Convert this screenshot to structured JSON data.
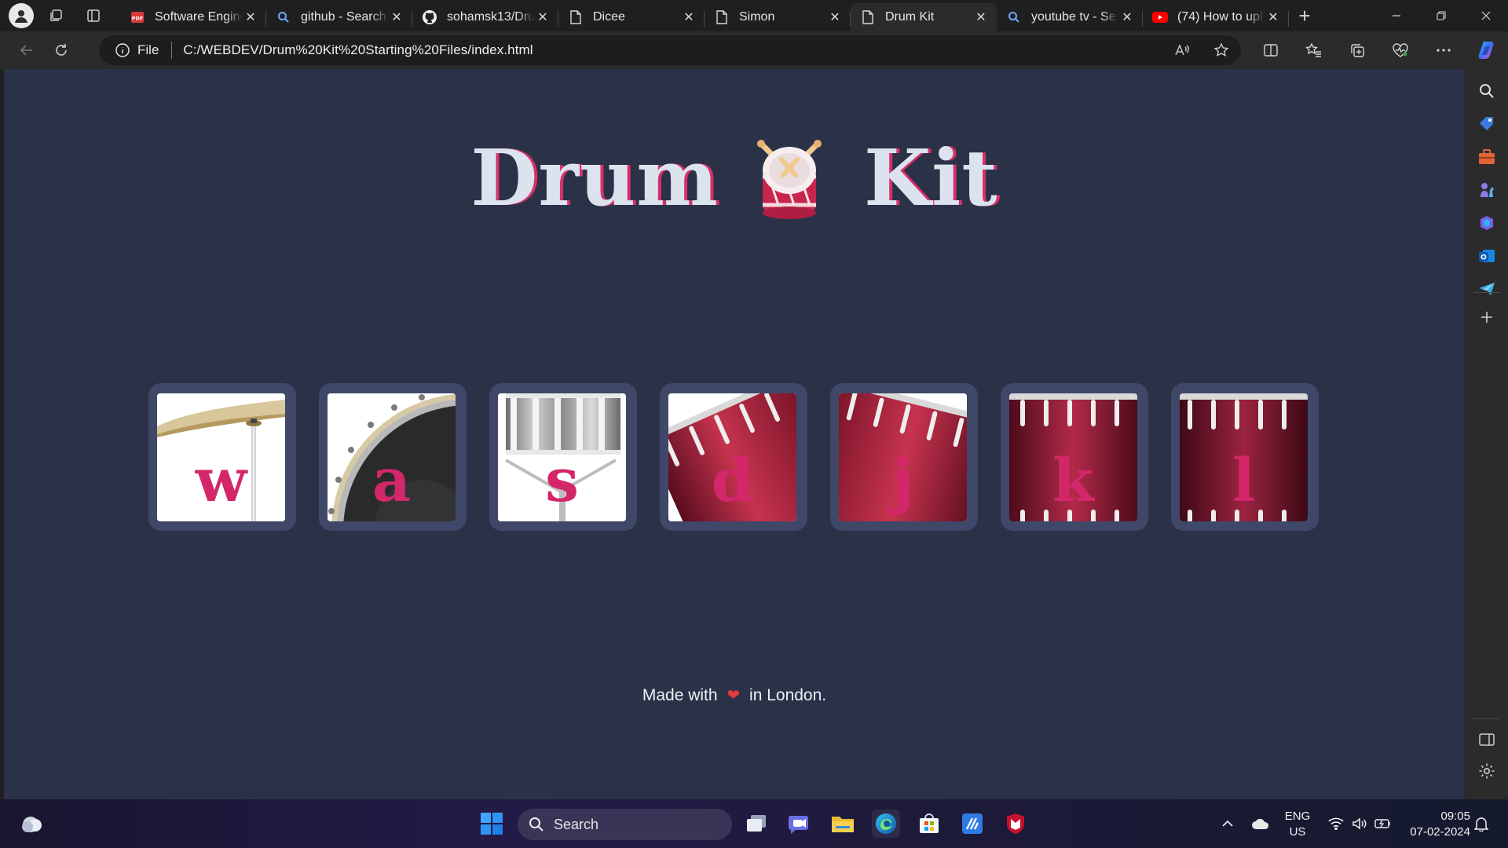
{
  "tabs": [
    {
      "title": "Software Engine",
      "favicon": "pdf-icon"
    },
    {
      "title": "github - Search",
      "favicon": "search-icon"
    },
    {
      "title": "sohamsk13/Dru",
      "favicon": "github-icon"
    },
    {
      "title": "Dicee",
      "favicon": "page-icon"
    },
    {
      "title": "Simon",
      "favicon": "page-icon"
    },
    {
      "title": "Drum Kit",
      "favicon": "page-icon",
      "active": true
    },
    {
      "title": "youtube tv - Se",
      "favicon": "search-icon"
    },
    {
      "title": "(74) How to upl",
      "favicon": "youtube-icon"
    }
  ],
  "address": {
    "scheme_label": "File",
    "url": "C:/WEBDEV/Drum%20Kit%20Starting%20Files/index.html"
  },
  "page": {
    "title_left": "Drum",
    "title_right": "Kit",
    "drums": [
      {
        "key": "w",
        "kind": "crash"
      },
      {
        "key": "a",
        "kind": "kick"
      },
      {
        "key": "s",
        "kind": "snare"
      },
      {
        "key": "d",
        "kind": "tom1"
      },
      {
        "key": "j",
        "kind": "tom2"
      },
      {
        "key": "k",
        "kind": "tom3"
      },
      {
        "key": "l",
        "kind": "tom4"
      }
    ],
    "footer_before": "Made with",
    "footer_after": "in London."
  },
  "taskbar": {
    "search_placeholder": "Search",
    "lang_line1": "ENG",
    "lang_line2": "US",
    "time": "09:05",
    "date": "07-02-2024"
  },
  "colors": {
    "page_bg": "#2b3248",
    "accent_pink": "#d3276a",
    "tile_frame": "#3f4868",
    "drum_red": "#a31f3c"
  }
}
